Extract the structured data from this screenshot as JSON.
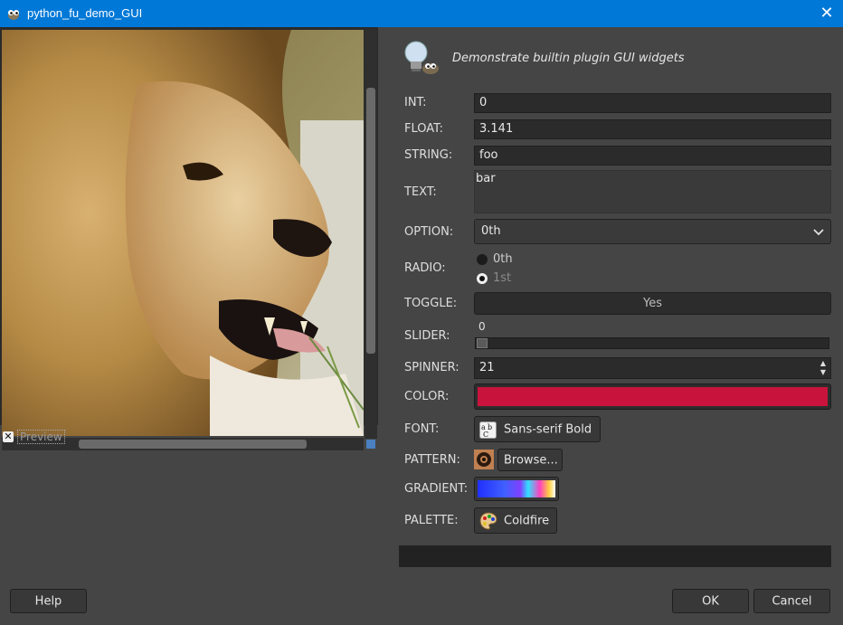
{
  "window": {
    "title": "python_fu_demo_GUI",
    "close_glyph": "✕"
  },
  "preview": {
    "checkbox_mark": "✕",
    "label": "Preview"
  },
  "header": {
    "description": "Demonstrate builtin plugin GUI widgets"
  },
  "form": {
    "int": {
      "label": "INT:",
      "value": "0"
    },
    "float": {
      "label": "FLOAT:",
      "value": "3.141"
    },
    "string": {
      "label": "STRING:",
      "value": "foo"
    },
    "text": {
      "label": "TEXT:",
      "value": "bar"
    },
    "option": {
      "label": "OPTION:",
      "value": "0th"
    },
    "radio": {
      "label": "RADIO:",
      "options": [
        "0th",
        "1st"
      ],
      "selected_index": 1
    },
    "toggle": {
      "label": "TOGGLE:",
      "value": "Yes"
    },
    "slider": {
      "label": "SLIDER:",
      "value": "0",
      "fraction": 0
    },
    "spinner": {
      "label": "SPINNER:",
      "value": "21"
    },
    "color": {
      "label": "COLOR:",
      "value": "#c8143c"
    },
    "font": {
      "label": "FONT:",
      "value": "Sans-serif Bold"
    },
    "pattern": {
      "label": "PATTERN:",
      "button": "Browse..."
    },
    "gradient": {
      "label": "GRADIENT:"
    },
    "palette": {
      "label": "PALETTE:",
      "value": "Coldfire"
    }
  },
  "buttons": {
    "help": "Help",
    "ok": "OK",
    "cancel": "Cancel"
  },
  "colors": {
    "titlebar": "#0078d7",
    "background": "#454545",
    "accent_color": "#c8143c"
  }
}
